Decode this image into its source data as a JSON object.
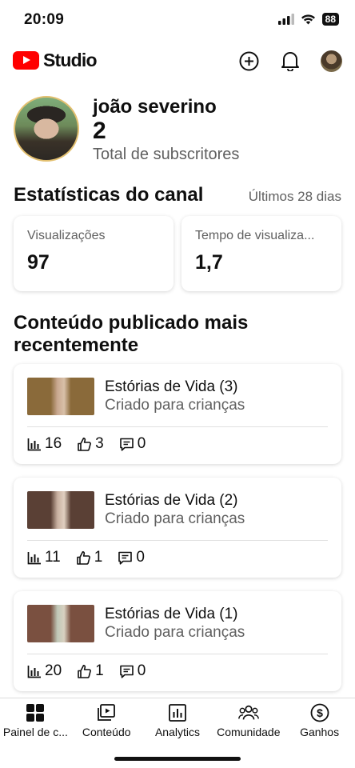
{
  "status_bar": {
    "time": "20:09",
    "battery": "88"
  },
  "header": {
    "logo_text": "Studio"
  },
  "channel": {
    "name": "joão severino",
    "subscriber_count": "2",
    "subscriber_label": "Total de subscritores"
  },
  "stats": {
    "title": "Estatísticas do canal",
    "period": "Últimos 28 dias",
    "cards": [
      {
        "label": "Visualizações",
        "value": "97"
      },
      {
        "label": "Tempo de visualiza...",
        "value": "1,7"
      }
    ]
  },
  "recent": {
    "title": "Conteúdo publicado mais recentemente",
    "videos": [
      {
        "title": "Estórias de Vida (3)",
        "subtitle": "Criado para crianças",
        "views": "16",
        "likes": "3",
        "comments": "0"
      },
      {
        "title": "Estórias de Vida (2)",
        "subtitle": "Criado para crianças",
        "views": "11",
        "likes": "1",
        "comments": "0"
      },
      {
        "title": "Estórias de Vida (1)",
        "subtitle": "Criado para crianças",
        "views": "20",
        "likes": "1",
        "comments": "0"
      }
    ]
  },
  "nav": {
    "items": [
      {
        "label": "Painel de c...",
        "icon": "dashboard-icon"
      },
      {
        "label": "Conteúdo",
        "icon": "content-icon"
      },
      {
        "label": "Analytics",
        "icon": "analytics-icon"
      },
      {
        "label": "Comunidade",
        "icon": "community-icon"
      },
      {
        "label": "Ganhos",
        "icon": "earn-icon"
      }
    ]
  }
}
